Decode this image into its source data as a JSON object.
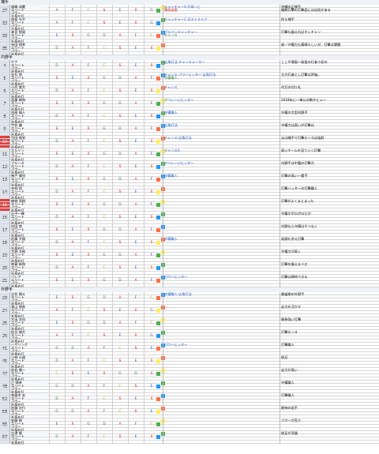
{
  "colors": {
    "blue_skill": "#1a57c9",
    "red_skill": "#d32f2f",
    "green_skill": "#2e7d32",
    "purple_skill": "#8e24aa",
    "orange_skill": "#e65100",
    "highlight_number": "#e04040",
    "section_bg": "#eef2f7"
  },
  "sections": [
    {
      "title": "捕手",
      "players": [
        {
          "no": "27",
          "name": "福嶋 成慶",
          "hand": "左投左打",
          "age": "28",
          "comment": "沖縄の正捕手",
          "comment2": "複数打撃の打撃面には自信がある",
          "skills": [
            {
              "text": "キャッチャーA 打球ノビ",
              "color": "blue"
            },
            {
              "text": "積極盗塁",
              "color": "red"
            }
          ],
          "highlight": false
        },
        {
          "no": "32",
          "name": "保坂 光平",
          "hand": "左投左打",
          "age": "25",
          "comment": "控え捕手",
          "comment2": "",
          "skills": [
            {
              "text": "キャッチャーC 対ストライク",
              "color": "blue"
            },
            {
              "text": "",
              "color": "blue"
            }
          ],
          "highlight": false
        },
        {
          "no": "33",
          "name": "本宮 智晃",
          "hand": "右投右打",
          "age": "23",
          "comment": "打撃も鍛えればオシチャン",
          "comment2": "",
          "skills": [
            {
              "text": "ブルペンキャッチャー",
              "color": "blue"
            },
            {
              "text": "チャンス",
              "color": "green"
            }
          ],
          "highlight": false
        },
        {
          "no": "35",
          "name": "市田 翔幸",
          "hand": "右投右打",
          "age": "20",
          "comment": "肩・守備力も素晴らしいが、打撃は課題",
          "comment2": "",
          "skills": [
            {
              "text": "",
              "color": "blue"
            },
            {
              "text": "",
              "color": "blue"
            }
          ],
          "highlight": false
        }
      ]
    },
    {
      "title": "内野手",
      "players": [
        {
          "no": "4",
          "name": "ケナ",
          "hand": "右投右打",
          "age": "42",
          "comment": "ここぞ場面一発狙の打者で初の",
          "comment2": "",
          "skills": [
            {
              "text": "広角打法 チャンスメーカー",
              "color": "blue"
            },
            {
              "text": "",
              "color": "green"
            }
          ],
          "highlight": false
        },
        {
          "no": "5",
          "name": "金丸 悠",
          "hand": "右投右打",
          "age": "38",
          "comment": "主力打者とし打撃は評価。",
          "comment2": "",
          "skills": [
            {
              "text": "チャンス パワーヒッター 広角打法",
              "color": "blue"
            },
            {
              "text": "守備職人",
              "color": "green"
            }
          ],
          "highlight": false
        },
        {
          "no": "6",
          "name": "小尻 貴大",
          "hand": "右投右打",
          "age": "40",
          "comment": "代打の切り札",
          "comment2": "",
          "skills": [
            {
              "text": "チャンス",
              "color": "blue"
            },
            {
              "text": "",
              "color": "green"
            }
          ],
          "highlight": false
        },
        {
          "no": "7",
          "name": "斎藤 稀和",
          "hand": "右投左打",
          "age": "24",
          "comment": "2018年に一軍公式戦デビュー",
          "comment2": "",
          "skills": [
            {
              "text": "アベレージヒッター",
              "color": "blue"
            },
            {
              "text": "",
              "color": "green"
            }
          ],
          "highlight": false
        },
        {
          "no": "8",
          "name": "池尾 晴人",
          "hand": "右投右打",
          "age": "21",
          "comment": "守備の大型内野手",
          "comment2": "",
          "skills": [
            {
              "text": "守備職人",
              "color": "blue"
            },
            {
              "text": "",
              "color": "green"
            }
          ],
          "highlight": false
        },
        {
          "no": "9",
          "name": "宇佐 謙",
          "hand": "右投右打",
          "age": "26",
          "comment": "守備力は高いが打撃は",
          "comment2": "",
          "skills": [
            {
              "text": "広角打法",
              "color": "blue"
            },
            {
              "text": "",
              "color": "green"
            }
          ],
          "highlight": false
        },
        {
          "no": "10",
          "name": "竹田 夜栄",
          "hand": "右投右打",
          "age": "20",
          "comment": "元は捕手で打撃センスは抜群",
          "comment2": "",
          "skills": [
            {
              "text": "チャンス 広角打法",
              "color": "blue"
            },
            {
              "text": "",
              "color": "green"
            }
          ],
          "highlight": true
        },
        {
          "no": "11",
          "name": "エルイン",
          "hand": "右投右打",
          "age": "34",
          "comment": "高いチームを見ていく打撃",
          "comment2": "",
          "skills": [
            {
              "text": "チャンスA",
              "color": "blue"
            },
            {
              "text": "",
              "color": "green"
            }
          ],
          "highlight": false
        },
        {
          "no": "12",
          "name": "ブルース",
          "hand": "右投右打",
          "age": "37",
          "comment": "内野手は中盤の打撃力",
          "comment2": "",
          "skills": [
            {
              "text": "アベレージヒッター",
              "color": "blue"
            },
            {
              "text": "",
              "color": "green"
            }
          ],
          "highlight": false
        },
        {
          "no": "13",
          "name": "神戸 雄也",
          "hand": "右投右打",
          "age": "22",
          "comment": "打撃の高い一塁手",
          "comment2": "",
          "skills": [
            {
              "text": "守備職人",
              "color": "blue"
            },
            {
              "text": "",
              "color": "green"
            }
          ],
          "highlight": false
        },
        {
          "no": "14",
          "name": "寺林 悟",
          "hand": "右投右打",
          "age": "29",
          "comment": "打撃ハッターの打撃職人",
          "comment2": "",
          "skills": [
            {
              "text": "",
              "color": "blue"
            },
            {
              "text": "",
              "color": "green"
            }
          ],
          "highlight": false
        },
        {
          "no": "15",
          "name": "楠城 亮樹",
          "hand": "右投右打",
          "age": "24",
          "comment": "打撃がよくまとまった",
          "comment2": "",
          "skills": [
            {
              "text": "",
              "color": "blue"
            },
            {
              "text": "",
              "color": "green"
            }
          ],
          "highlight": true
        },
        {
          "no": "16",
          "name": "石子一輝",
          "hand": "右投右打",
          "age": "31",
          "comment": "守備がポロポロだが",
          "comment2": "",
          "skills": [
            {
              "text": "",
              "color": "blue"
            },
            {
              "text": "",
              "color": "green"
            }
          ],
          "highlight": false
        },
        {
          "no": "17",
          "name": "村田 悠",
          "hand": "右投右打",
          "age": "30",
          "comment": "内野なら守備はそつなく",
          "comment2": "",
          "skills": [
            {
              "text": "",
              "color": "blue"
            },
            {
              "text": "",
              "color": "green"
            }
          ],
          "highlight": false
        },
        {
          "no": "18",
          "name": "佐藤 大福",
          "hand": "右投右打",
          "age": "24",
          "comment": "笑顔も交え打撃",
          "comment2": "",
          "skills": [
            {
              "text": "守備職人",
              "color": "blue"
            },
            {
              "text": "",
              "color": "green"
            }
          ],
          "highlight": false
        },
        {
          "no": "19",
          "name": "大野 文絵",
          "hand": "右投右打",
          "age": "27",
          "comment": "守備力が高く",
          "comment2": "",
          "skills": [
            {
              "text": "",
              "color": "blue"
            },
            {
              "text": "",
              "color": "green"
            }
          ],
          "highlight": false
        },
        {
          "no": "20",
          "name": "神賀 新和",
          "hand": "右投右打",
          "age": "23",
          "comment": "打撃を鍛えるべき",
          "comment2": "",
          "skills": [
            {
              "text": "",
              "color": "blue"
            },
            {
              "text": "",
              "color": "green"
            }
          ],
          "highlight": false
        },
        {
          "no": "21",
          "name": "パレア",
          "hand": "右投右打",
          "age": "32",
          "comment": "打撃は期待できる",
          "comment2": "",
          "skills": [
            {
              "text": "パワーヒッター",
              "color": "blue"
            },
            {
              "text": "",
              "color": "green"
            }
          ],
          "highlight": false
        }
      ]
    },
    {
      "title": "外野手",
      "players": [
        {
          "no": "23",
          "name": "吉住 晴斗",
          "hand": "右投右打",
          "age": "28",
          "comment": "最盛期の外野手",
          "comment2": "",
          "skills": [
            {
              "text": "守備職人 広角打法",
              "color": "blue"
            },
            {
              "text": "",
              "color": "green"
            }
          ],
          "highlight": false
        },
        {
          "no": "24",
          "name": "青山 朋彦",
          "hand": "右投右打",
          "age": "27",
          "comment": "走力を活かす",
          "comment2": "",
          "skills": [
            {
              "text": "",
              "color": "blue"
            },
            {
              "text": "",
              "color": "green"
            }
          ],
          "highlight": false
        },
        {
          "no": "25",
          "name": "大出 芝也",
          "hand": "右投右打",
          "age": "24",
          "comment": "勝負強い打撃",
          "comment2": "",
          "skills": [
            {
              "text": "",
              "color": "blue"
            },
            {
              "text": "",
              "color": "green"
            }
          ],
          "highlight": false
        },
        {
          "no": "26",
          "name": "佐谷 雄大",
          "hand": "右投右打",
          "age": "22",
          "comment": "打撃センス",
          "comment2": "",
          "skills": [
            {
              "text": "",
              "color": "blue"
            },
            {
              "text": "",
              "color": "green"
            }
          ],
          "highlight": false
        },
        {
          "no": "41",
          "name": "ヘザリング",
          "hand": "右投右打",
          "age": "30",
          "comment": "打撃職人",
          "comment2": "",
          "skills": [
            {
              "text": "パワーヒッター",
              "color": "blue"
            },
            {
              "text": "",
              "color": "green"
            }
          ],
          "highlight": false
        },
        {
          "no": "45",
          "name": "小林 公道",
          "hand": "右投右打",
          "age": "26",
          "comment": "俊足",
          "comment2": "",
          "skills": [
            {
              "text": "",
              "color": "blue"
            },
            {
              "text": "",
              "color": "green"
            }
          ],
          "highlight": false
        },
        {
          "no": "47",
          "name": "佐伯 慎一",
          "hand": "右投右打",
          "age": "29",
          "comment": "走力が高い",
          "comment2": "",
          "skills": [
            {
              "text": "",
              "color": "blue"
            },
            {
              "text": "",
              "color": "green"
            }
          ],
          "highlight": false
        },
        {
          "no": "48",
          "name": "辻 晴彦",
          "hand": "右投右打",
          "age": "25",
          "comment": "守備職人",
          "comment2": "",
          "skills": [
            {
              "text": "",
              "color": "blue"
            },
            {
              "text": "",
              "color": "green"
            }
          ],
          "highlight": false
        },
        {
          "no": "52",
          "name": "茶屋木 宏",
          "hand": "右投右打",
          "age": "33",
          "comment": "打撃職人",
          "comment2": "",
          "skills": [
            {
              "text": "",
              "color": "blue"
            },
            {
              "text": "",
              "color": "green"
            }
          ],
          "highlight": false
        },
        {
          "no": "58",
          "name": "佐藤 壮行",
          "hand": "右投右打",
          "age": "21",
          "comment": "期待の若手",
          "comment2": "",
          "skills": [
            {
              "text": "",
              "color": "blue"
            },
            {
              "text": "",
              "color": "green"
            }
          ],
          "highlight": false
        },
        {
          "no": "65",
          "name": "安藤 樹",
          "hand": "右投右打",
          "age": "22",
          "comment": "パワーが売り",
          "comment2": "",
          "skills": [
            {
              "text": "",
              "color": "blue"
            },
            {
              "text": "",
              "color": "green"
            }
          ],
          "highlight": false
        },
        {
          "no": "67",
          "name": "吉澤 隆",
          "hand": "右投右打",
          "age": "24",
          "comment": "俊足が武器",
          "comment2": "",
          "skills": [
            {
              "text": "",
              "color": "blue"
            },
            {
              "text": "",
              "color": "green"
            }
          ],
          "highlight": false
        }
      ]
    }
  ],
  "sub_labels": {
    "row1": "エリート",
    "row2": "パワー",
    "stat_keys": [
      "弾道",
      "ミート",
      "パワー",
      "走力",
      "肩力",
      "守備力",
      "捕球"
    ]
  }
}
